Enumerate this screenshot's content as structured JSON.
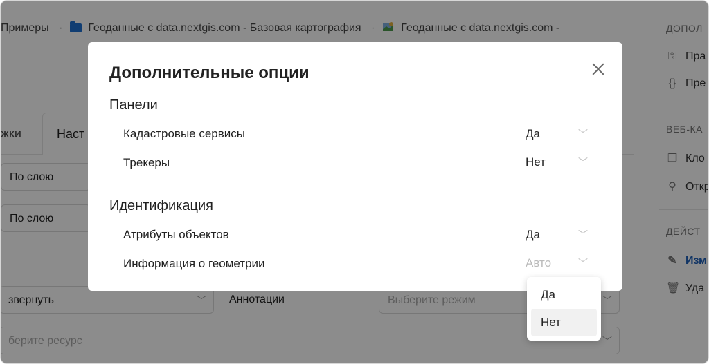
{
  "breadcrumb": {
    "items": [
      "Примеры",
      "Геоданные с data.nextgis.com - Базовая картография",
      "Геоданные с data.nextgis.com -"
    ]
  },
  "background_tabs": [
    "жки",
    "Наст"
  ],
  "background_form": {
    "by_layer_1": "По слою",
    "by_layer_2": "По слою",
    "expand": "звернуть",
    "annotations": "Аннотации",
    "mode_placeholder": "Выберите режим",
    "resource_placeholder": "берите ресурс"
  },
  "right_panel": {
    "section_1": "ДОПОЛ",
    "item_1": "Пра",
    "item_2": "Пре",
    "section_2": "ВЕБ-КА",
    "item_3": "Кло",
    "item_4": "Откр",
    "section_3": "ДЕЙСТ",
    "item_5": "Изм",
    "item_6": "Уда"
  },
  "modal": {
    "title": "Дополнительные опции",
    "section_panels": "Панели",
    "section_identification": "Идентификация",
    "options": [
      {
        "label": "Кадастровые сервисы",
        "value": "Да"
      },
      {
        "label": "Трекеры",
        "value": "Нет"
      },
      {
        "label": "Атрибуты объектов",
        "value": "Да"
      },
      {
        "label": "Информация о геометрии",
        "value": "Авто"
      }
    ]
  },
  "dropdown": {
    "options": [
      "Да",
      "Нет"
    ]
  },
  "colors": {
    "link": "#1e5fb8",
    "folder": "#1e6fd0",
    "overlay": "rgba(0,0,0,0.45)"
  }
}
